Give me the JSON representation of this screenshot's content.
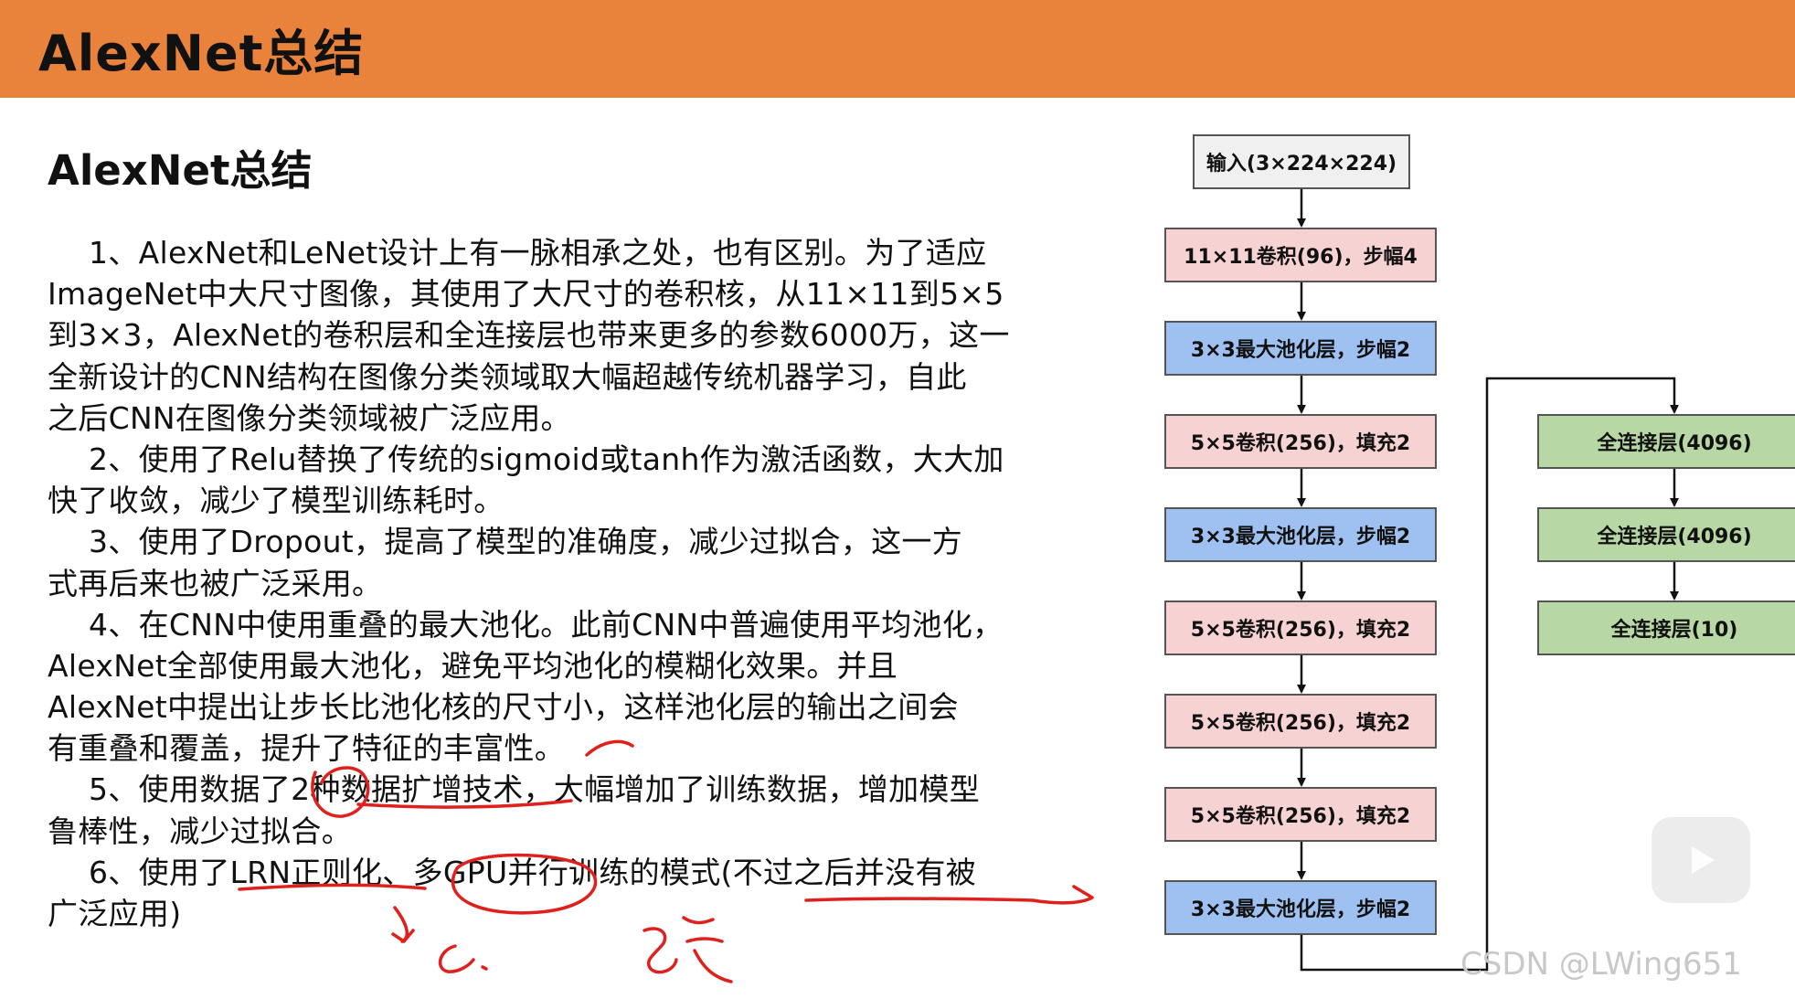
{
  "header": {
    "title": "AlexNet总结"
  },
  "section": {
    "title": "AlexNet总结"
  },
  "body_lines": [
    {
      "text": "1、AlexNet和LeNet设计上有一脉相承之处，也有区别。为了适应",
      "indent": true
    },
    {
      "text": "ImageNet中大尺寸图像，其使用了大尺寸的卷积核，从11×11到5×5",
      "indent": false
    },
    {
      "text": "到3×3，AlexNet的卷积层和全连接层也带来更多的参数6000万，这一",
      "indent": false
    },
    {
      "text": "全新设计的CNN结构在图像分类领域取大幅超越传统机器学习，自此",
      "indent": false
    },
    {
      "text": "之后CNN在图像分类领域被广泛应用。",
      "indent": false
    },
    {
      "text": "2、使用了Relu替换了传统的sigmoid或tanh作为激活函数，大大加",
      "indent": true
    },
    {
      "text": "快了收敛，减少了模型训练耗时。",
      "indent": false
    },
    {
      "text": "3、使用了Dropout，提高了模型的准确度，减少过拟合，这一方",
      "indent": true
    },
    {
      "text": "式再后来也被广泛采用。",
      "indent": false
    },
    {
      "text": "4、在CNN中使用重叠的最大池化。此前CNN中普遍使用平均池化，",
      "indent": true
    },
    {
      "text": "AlexNet全部使用最大池化，避免平均池化的模糊化效果。并且",
      "indent": false
    },
    {
      "text": "AlexNet中提出让步长比池化核的尺寸小，这样池化层的输出之间会",
      "indent": false
    },
    {
      "text": "有重叠和覆盖，提升了特征的丰富性。",
      "indent": false
    },
    {
      "text": "5、使用数据了2种数据扩增技术，大幅增加了训练数据，增加模型",
      "indent": true
    },
    {
      "text": "鲁棒性，减少过拟合。",
      "indent": false
    },
    {
      "text": "6、使用了LRN正则化、多GPU并行训练的模式(不过之后并没有被",
      "indent": true
    },
    {
      "text": "广泛应用)",
      "indent": false
    }
  ],
  "diagram": {
    "input": "输入(3×224×224)",
    "left_column": [
      {
        "label": "11×11卷积(96)，步幅4",
        "kind": "conv"
      },
      {
        "label": "3×3最大池化层，步幅2",
        "kind": "pool"
      },
      {
        "label": "5×5卷积(256)，填充2",
        "kind": "conv"
      },
      {
        "label": "3×3最大池化层，步幅2",
        "kind": "pool"
      },
      {
        "label": "5×5卷积(256)，填充2",
        "kind": "conv"
      },
      {
        "label": "5×5卷积(256)，填充2",
        "kind": "conv"
      },
      {
        "label": "5×5卷积(256)，填充2",
        "kind": "conv"
      },
      {
        "label": "3×3最大池化层，步幅2",
        "kind": "pool"
      }
    ],
    "right_column": [
      {
        "label": "全连接层(4096)",
        "kind": "fc"
      },
      {
        "label": "全连接层(4096)",
        "kind": "fc"
      },
      {
        "label": "全连接层(10)",
        "kind": "fc"
      }
    ]
  },
  "colors": {
    "header": "#e9823a",
    "conv": "#f6d2d3",
    "pool": "#9fc1f2",
    "fc": "#b7d7a5",
    "ink": "#e0201c"
  },
  "watermark": "CSDN @LWing651"
}
